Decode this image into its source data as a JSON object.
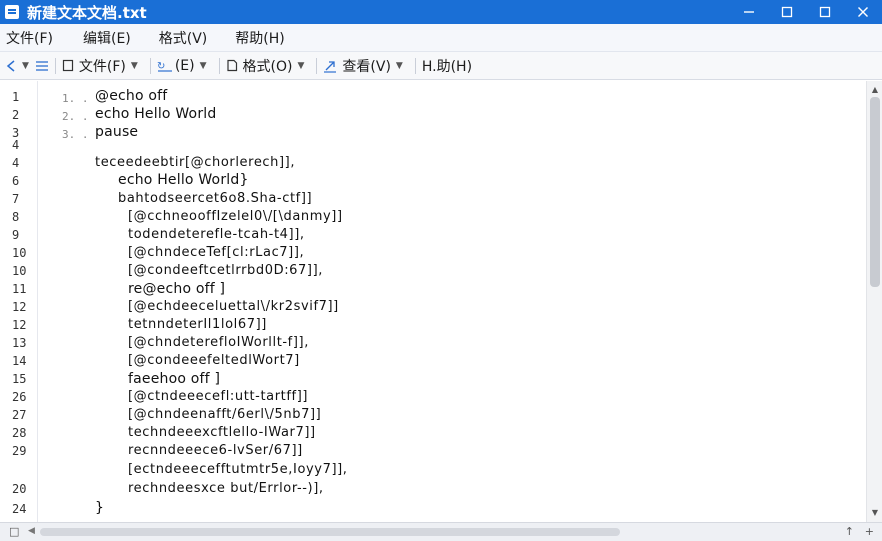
{
  "window": {
    "title": "新建文本文档.txt",
    "title_color": "#1a6fd6"
  },
  "menu": [
    "文件(F)",
    "编辑(E)",
    "格式(V)",
    "帮助(H)"
  ],
  "toolbar": {
    "file_label": "文件(F)",
    "edit_label": "(E)",
    "format_label": "格式(O)",
    "view_label": "查看(V)",
    "help_label": "H.助(H)"
  },
  "editor": {
    "line_numbers": [
      "1",
      "2",
      "3",
      "4",
      "4",
      "6",
      "7",
      "8",
      "9",
      "10",
      "10",
      "11",
      "12",
      "12",
      "13",
      "14",
      "15",
      "26",
      "27",
      "28",
      "29",
      "20",
      "24"
    ],
    "inner_numbers": [
      "1. .",
      "2. .",
      "3. ."
    ],
    "lines": [
      "@echo off",
      "echo Hello World",
      "pause",
      "",
      "teceedeebtir[@chorlerech]],",
      "echo Hello World}",
      "bahtodseercet6o8.Sha-ctf]]",
      "[@cchneooffIzelel0\\/[\\danmy]]",
      "todendeterefle-tcah-t4]],",
      "[@chndeceTef[cl:rLac7]],",
      "[@condeeftcetlrrbd0D:67]],",
      "re@echo off ]",
      "[@echdeeceluettal\\/kr2svif7]]",
      "tetnndeterIl1lol67]]",
      "[@chndeterefloIWorllt-f]],",
      "[@condeeefeltedlWort7]",
      "faeehoo off ]",
      "[@ctndeeecefl:utt-tartff]]",
      "[@chndeenafft/6erl\\/5nb7]]",
      "techndeeexcftlello-IWar7]]",
      "recnndeeece6-lvSer/67]]",
      "[ectndeeecefftutmtr5e,Ioyy7]],",
      "rechndeesxce but/Errlor--)],",
      "}"
    ]
  },
  "status": {
    "left_icon": "□",
    "right_icon": "↑",
    "right_icon2": "+"
  }
}
